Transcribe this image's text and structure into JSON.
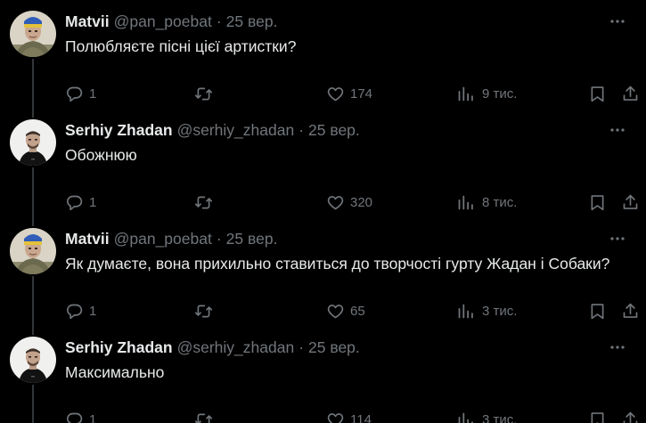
{
  "tweets": [
    {
      "name": "Matvii",
      "handle": "@pan_poebat",
      "separator": "·",
      "time": "25 вер.",
      "text": "Полюбляєте пісні цієї артистки?",
      "replies": "1",
      "likes": "174",
      "views": "9 тис.",
      "avatar": "matvii"
    },
    {
      "name": "Serhiy Zhadan",
      "handle": "@serhiy_zhadan",
      "separator": "·",
      "time": "25 вер.",
      "text": "Обожнюю",
      "replies": "1",
      "likes": "320",
      "views": "8 тис.",
      "avatar": "zhadan"
    },
    {
      "name": "Matvii",
      "handle": "@pan_poebat",
      "separator": "·",
      "time": "25 вер.",
      "text": "Як думаєте, вона прихильно ставиться до творчості гурту Жадан і Собаки?",
      "replies": "1",
      "likes": "65",
      "views": "3 тис.",
      "avatar": "matvii"
    },
    {
      "name": "Serhiy Zhadan",
      "handle": "@serhiy_zhadan",
      "separator": "·",
      "time": "25 вер.",
      "text": "Максимально",
      "replies": "1",
      "likes": "114",
      "views": "3 тис.",
      "avatar": "zhadan"
    }
  ],
  "icons": {
    "reply": "reply-icon",
    "retweet": "retweet-icon",
    "like": "heart-icon",
    "views": "views-bar-chart-icon",
    "bookmark": "bookmark-icon",
    "share": "share-icon",
    "more": "more-dots-icon"
  },
  "colors": {
    "background": "#000000",
    "text": "#e7e9ea",
    "secondary": "#71767b",
    "thread_line": "#333639"
  }
}
